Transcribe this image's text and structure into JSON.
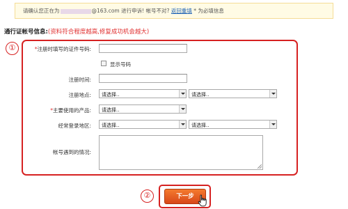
{
  "notice": {
    "prefix": "请确认您正在为",
    "email_domain": "@163.com",
    "middle": "进行申诉!",
    "question": "帐号不对?",
    "link": "返回重填",
    "suffix": "* 为必填信息"
  },
  "section": {
    "title": "通行证帐号信息:",
    "hint": "(资料符合程度越高,修复成功机会越大)"
  },
  "markers": {
    "one": "①",
    "two": "②"
  },
  "form": {
    "id_label_req": "*",
    "id_label": "注册时填写的证件号码:",
    "show_number": "显示号码",
    "reg_time_label": "注册时间:",
    "reg_place_label": "注册地点:",
    "product_label_req": "*",
    "product_label": "主要使用的产品:",
    "region_label": "经常登录地区:",
    "situation_label": "帐号遇到的情况:",
    "select_placeholder": "请选择.."
  },
  "next_button": "下一步"
}
